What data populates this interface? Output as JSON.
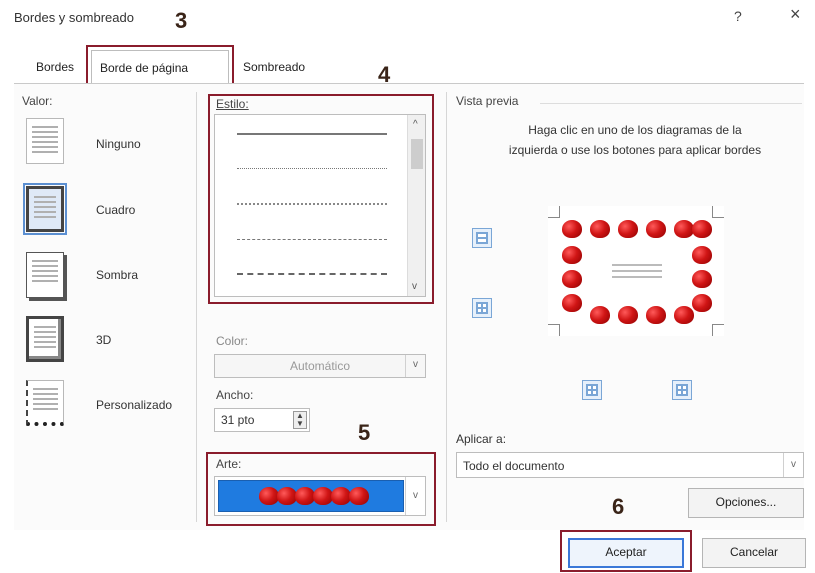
{
  "dialog": {
    "title": "Bordes y sombreado",
    "help_glyph": "?",
    "close_glyph": "×"
  },
  "callouts": {
    "c3": "3",
    "c4": "4",
    "c5": "5",
    "c6": "6"
  },
  "tabs": [
    {
      "label": "Bordes"
    },
    {
      "label": "Borde de página",
      "active": true
    },
    {
      "label": "Sombreado"
    }
  ],
  "valor": {
    "heading": "Valor:",
    "settings": [
      {
        "label": "Ninguno",
        "icon": "setting-none-icon"
      },
      {
        "label": "Cuadro",
        "icon": "setting-box-icon",
        "selected": true
      },
      {
        "label": "Sombra",
        "icon": "setting-shadow-icon"
      },
      {
        "label": "3D",
        "icon": "setting-3d-icon"
      },
      {
        "label": "Personalizado",
        "icon": "setting-custom-icon"
      }
    ]
  },
  "estilo": {
    "heading": "Estilo:",
    "styles": [
      "solid",
      "dotted",
      "dense-dotted",
      "dashed",
      "dash-dot"
    ]
  },
  "color": {
    "label": "Color:",
    "value": "Automático"
  },
  "ancho": {
    "label": "Ancho:",
    "value": "31 pto"
  },
  "arte": {
    "label": "Arte:"
  },
  "preview": {
    "heading": "Vista previa",
    "instructions": "Haga clic en uno de los diagramas de la izquierda o use los botones para aplicar bordes"
  },
  "aplicar": {
    "label": "Aplicar a:",
    "value": "Todo el documento"
  },
  "buttons": {
    "opciones": "Opciones...",
    "aceptar": "Aceptar",
    "cancelar": "Cancelar"
  },
  "colors": {
    "accent": "#3b78d8",
    "callout_box": "#8a1c2c",
    "art_blue": "#1f7be0",
    "apple_red": "#d01515"
  }
}
